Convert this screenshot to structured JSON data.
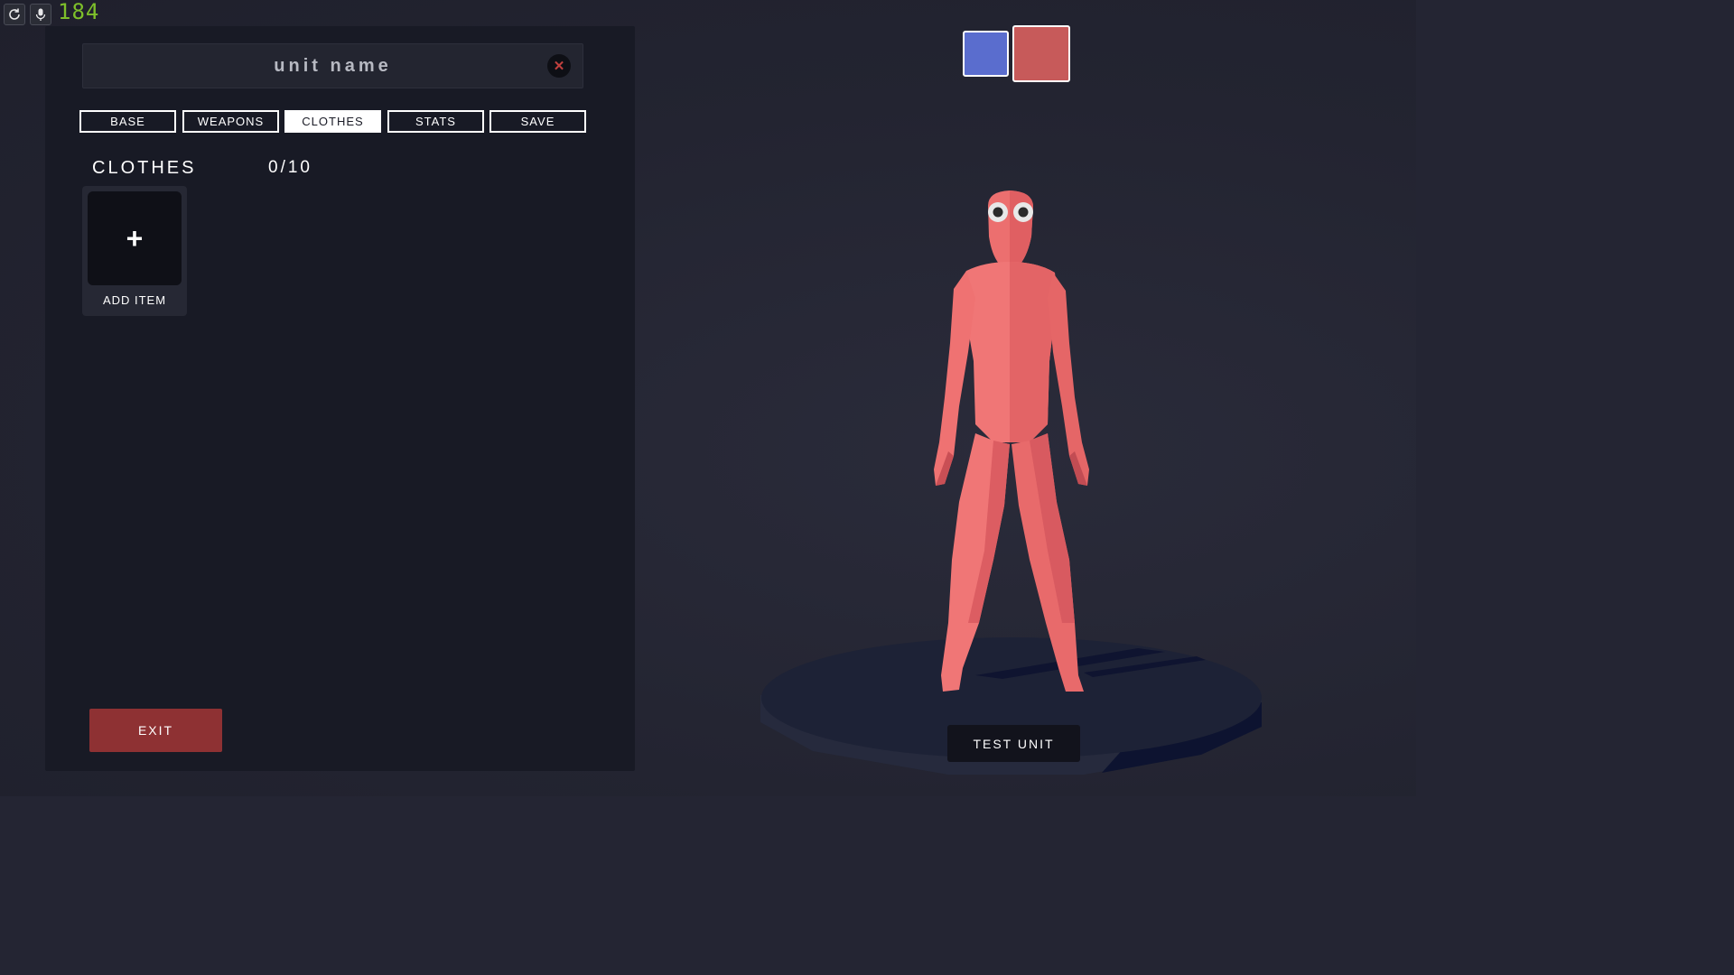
{
  "overlay": {
    "fps_counter": "184",
    "icons": [
      "refresh-icon",
      "microphone-icon"
    ]
  },
  "editor": {
    "unit_name_placeholder": "unit name",
    "clear_icon": "close-icon",
    "tabs": [
      {
        "label": "BASE",
        "active": false
      },
      {
        "label": "WEAPONS",
        "active": false
      },
      {
        "label": "CLOTHES",
        "active": true
      },
      {
        "label": "STATS",
        "active": false
      },
      {
        "label": "SAVE",
        "active": false
      }
    ],
    "section_title": "CLOTHES",
    "section_count": "0/10",
    "add_item_label": "ADD ITEM",
    "add_item_icon": "plus-icon",
    "exit_label": "EXIT"
  },
  "preview": {
    "team_colors": [
      {
        "name": "blue-team",
        "color": "#5a6dce",
        "selected": false
      },
      {
        "name": "red-team",
        "color": "#c75a5a",
        "selected": true
      }
    ],
    "test_unit_label": "TEST UNIT"
  },
  "colors": {
    "panel_bg": "#181a25",
    "exit_red": "#8e3133",
    "unit_skin": "#ec6f6f",
    "pedestal": "#1d2236",
    "fps_green": "#7ec02a"
  }
}
